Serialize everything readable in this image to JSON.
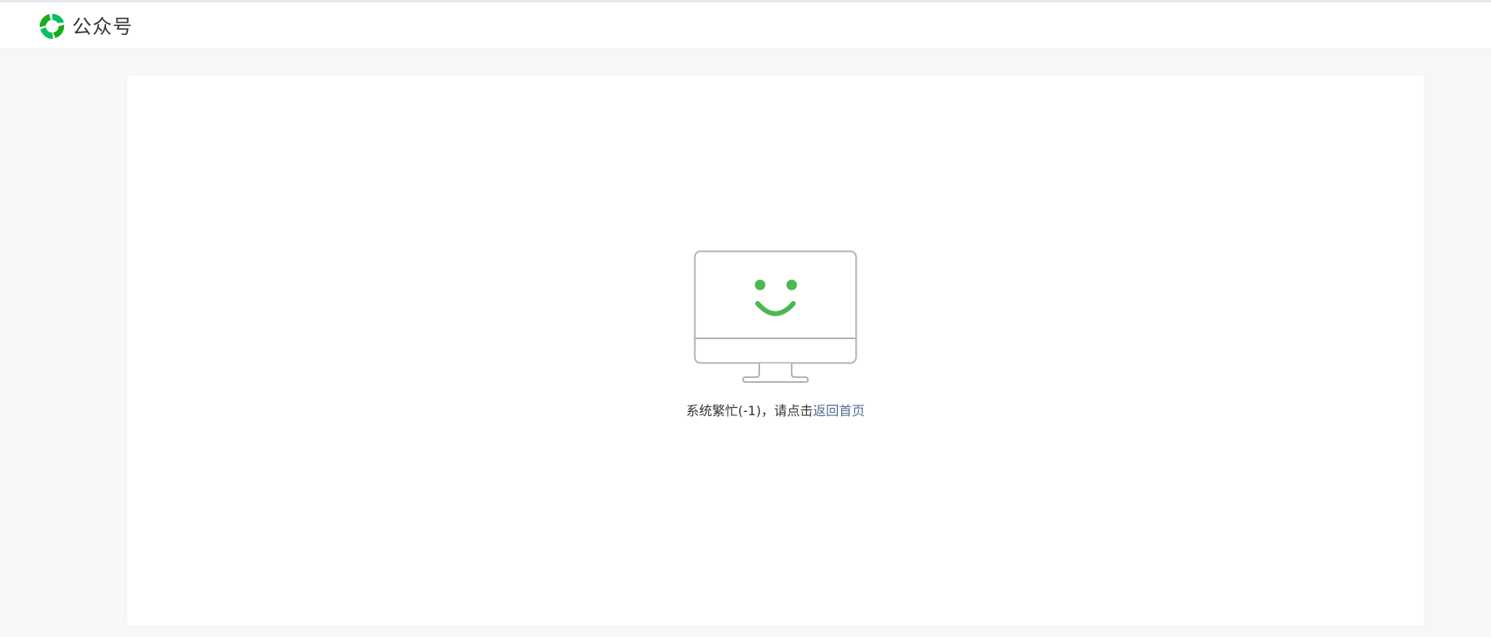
{
  "header": {
    "logo_icon": "wechat-official-accounts-logo-icon",
    "logo_text": "公众号",
    "brand_color": "#07c160"
  },
  "error": {
    "illustration": "monitor-smiley-icon",
    "message_prefix": "系统繁忙(-1)，请点击",
    "home_link_label": "返回首页",
    "link_color": "#576b95",
    "smiley_color": "#4cb751"
  }
}
